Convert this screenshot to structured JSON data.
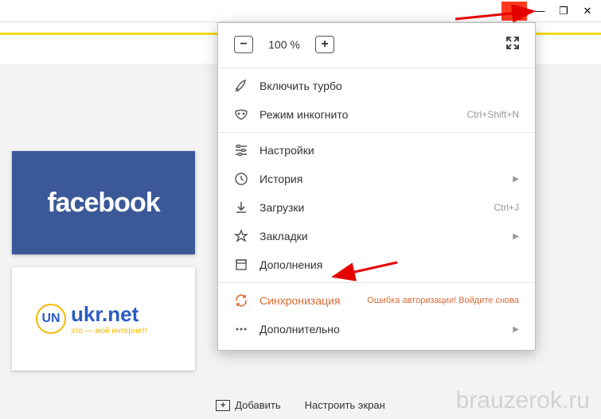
{
  "window": {
    "hamburger": "≡",
    "minimize": "—",
    "maximize": "❐",
    "close": "✕"
  },
  "zoom": {
    "value": "100 %",
    "minus": "−",
    "plus": "+"
  },
  "menu": {
    "turbo": "Включить турбо",
    "incognito": "Режим инкогнито",
    "incognito_shortcut": "Ctrl+Shift+N",
    "settings": "Настройки",
    "history": "История",
    "downloads": "Загрузки",
    "downloads_shortcut": "Ctrl+J",
    "bookmarks": "Закладки",
    "addons": "Дополнения",
    "sync": "Синхронизация",
    "sync_error": "Ошибка авторизации! Войдите снова",
    "more": "Дополнительно"
  },
  "tiles": {
    "facebook": "facebook",
    "ukr_main": "ukr.net",
    "ukr_sub": "это — мой интернет!",
    "ukr_badge": "UN"
  },
  "bottom": {
    "add": "Добавить",
    "configure": "Настроить экран"
  },
  "watermark": "brauzerok.ru"
}
